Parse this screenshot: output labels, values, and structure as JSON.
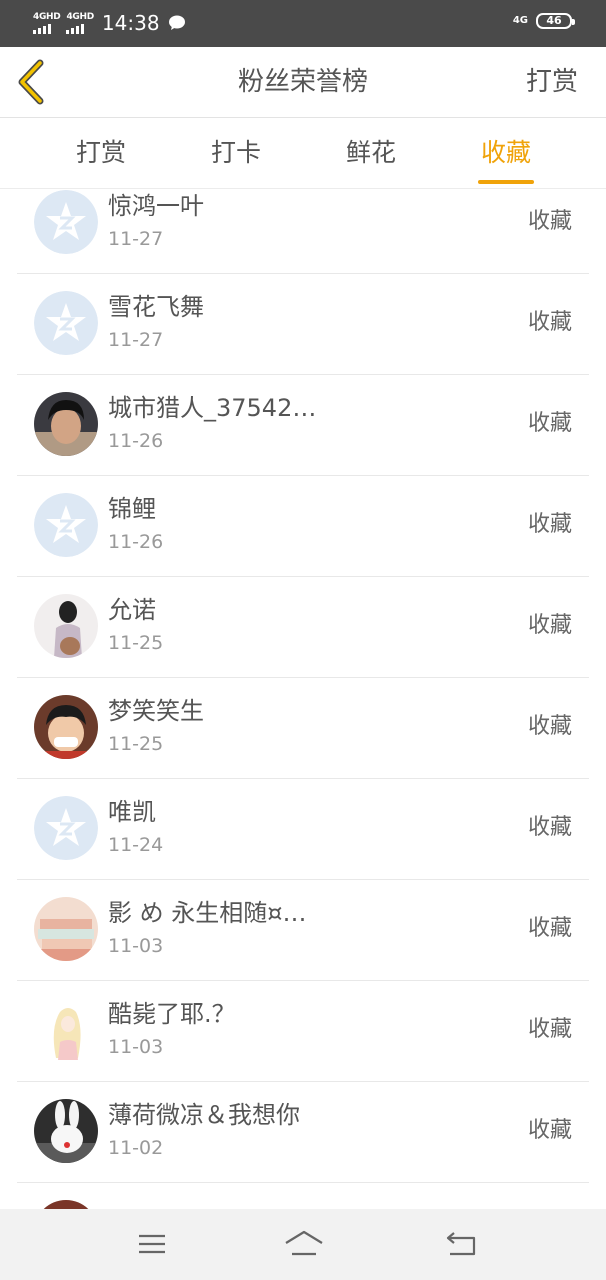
{
  "status_bar": {
    "network_1": "4GHD",
    "network_2": "4GHD",
    "time": "14:38",
    "network_right": "4G",
    "battery": "46"
  },
  "header": {
    "title": "粉丝荣誉榜",
    "action_label": "打赏"
  },
  "tabs": [
    {
      "label": "打赏",
      "active": false
    },
    {
      "label": "打卡",
      "active": false
    },
    {
      "label": "鲜花",
      "active": false
    },
    {
      "label": "收藏",
      "active": true
    }
  ],
  "colors": {
    "accent": "#f0a30a",
    "status_bar": "#4a4a4a",
    "default_avatar": "#dde8f4"
  },
  "list": {
    "items": [
      {
        "name": "惊鸿一叶",
        "date": "11-27",
        "action": "收藏",
        "avatar": "default-star-avatar"
      },
      {
        "name": "雪花飞舞",
        "date": "11-27",
        "action": "收藏",
        "avatar": "default-star-avatar"
      },
      {
        "name": "城市猎人_37542…",
        "date": "11-26",
        "action": "收藏",
        "avatar": "photo-boy-avatar"
      },
      {
        "name": "锦鲤",
        "date": "11-26",
        "action": "收藏",
        "avatar": "default-star-avatar"
      },
      {
        "name": "允诺",
        "date": "11-25",
        "action": "收藏",
        "avatar": "photo-girl-back-avatar"
      },
      {
        "name": "梦笑笑生",
        "date": "11-25",
        "action": "收藏",
        "avatar": "cartoon-luffy-avatar"
      },
      {
        "name": "唯凯",
        "date": "11-24",
        "action": "收藏",
        "avatar": "default-star-avatar"
      },
      {
        "name": "影 め 永生相随¤…",
        "date": "11-03",
        "action": "收藏",
        "avatar": "books-avatar"
      },
      {
        "name": "酷毙了耶.？",
        "date": "11-03",
        "action": "收藏",
        "avatar": "anime-girl-avatar"
      },
      {
        "name": "薄荷微凉＆我想你",
        "date": "11-02",
        "action": "收藏",
        "avatar": "rabbit-avatar"
      }
    ]
  },
  "nav_bar": {
    "icons": [
      "menu-icon",
      "home-icon",
      "back-icon"
    ]
  }
}
